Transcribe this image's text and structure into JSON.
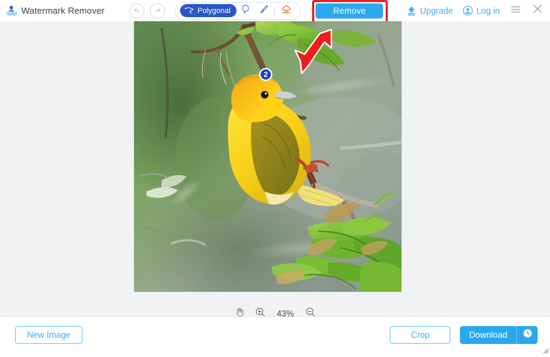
{
  "app": {
    "title": "Watermark Remover",
    "logo_icon": "watermark-logo-icon"
  },
  "toolbar": {
    "undo_icon": "undo-icon",
    "redo_icon": "redo-icon",
    "tools": [
      {
        "id": "polygonal",
        "label": "Polygonal",
        "icon": "polygonal-lasso-icon",
        "active": true
      },
      {
        "id": "lasso",
        "label": "",
        "icon": "lasso-icon",
        "active": false
      },
      {
        "id": "brush",
        "label": "",
        "icon": "brush-icon",
        "active": false
      },
      {
        "id": "eraser",
        "label": "",
        "icon": "eraser-icon",
        "active": false
      }
    ],
    "remove_label": "Remove",
    "highlight_color": "#ef1c22",
    "accent_color": "#2aa8ee",
    "active_tool_color": "#2b55c6",
    "eraser_color": "#f07030"
  },
  "account": {
    "upgrade_label": "Upgrade",
    "upgrade_icon": "upload-arrow-icon",
    "login_label": "Log in",
    "login_icon": "user-circle-icon",
    "menu_icon": "hamburger-menu-icon",
    "close_icon": "close-icon"
  },
  "canvas": {
    "annotation_badge": "2",
    "annotation_badge_color": "#1b3fc4",
    "arrow_color": "#ef1c22",
    "background": "#f1f2f3",
    "image_alt": "Yellow weaver bird hanging upside down on a branch with green leaves"
  },
  "zoom": {
    "pan_icon": "hand-pan-icon",
    "zoom_in_icon": "zoom-in-icon",
    "zoom_out_icon": "zoom-out-icon",
    "level": "43%"
  },
  "footer": {
    "new_image_label": "New Image",
    "crop_label": "Crop",
    "download_label": "Download",
    "download_history_icon": "clock-icon"
  }
}
